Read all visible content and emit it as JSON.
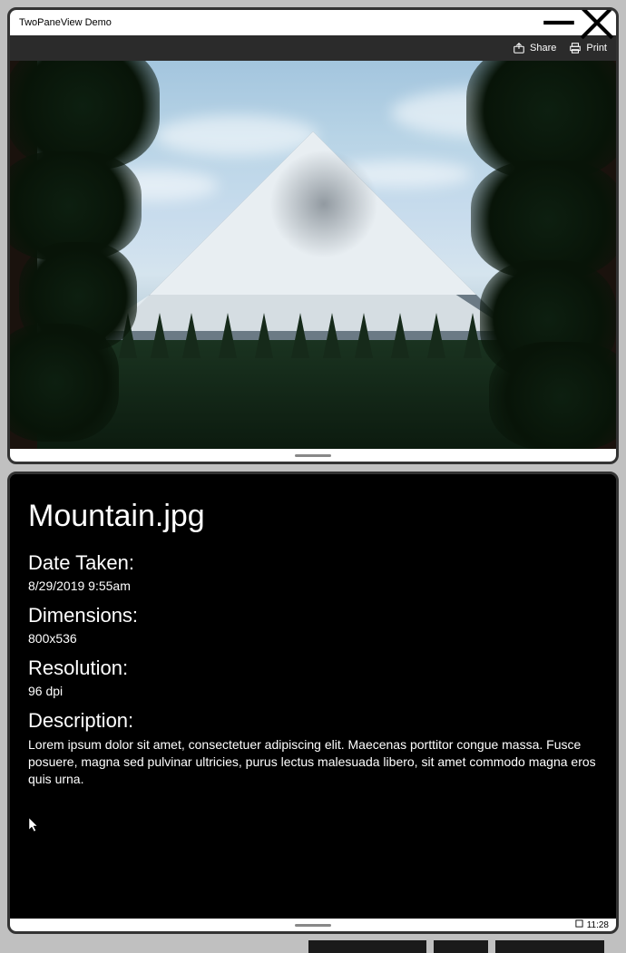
{
  "window": {
    "title": "TwoPaneView Demo"
  },
  "commandbar": {
    "share": "Share",
    "print": "Print"
  },
  "details": {
    "filename": "Mountain.jpg",
    "date_label": "Date Taken:",
    "date_value": "8/29/2019 9:55am",
    "dimensions_label": "Dimensions:",
    "dimensions_value": "800x536",
    "resolution_label": "Resolution:",
    "resolution_value": "96 dpi",
    "description_label": "Description:",
    "description_value": "Lorem ipsum dolor sit amet, consectetuer adipiscing elit. Maecenas porttitor congue massa. Fusce posuere, magna sed pulvinar ultricies, purus lectus malesuada libero, sit amet commodo magna eros quis urna."
  },
  "system": {
    "time": "11:28"
  }
}
